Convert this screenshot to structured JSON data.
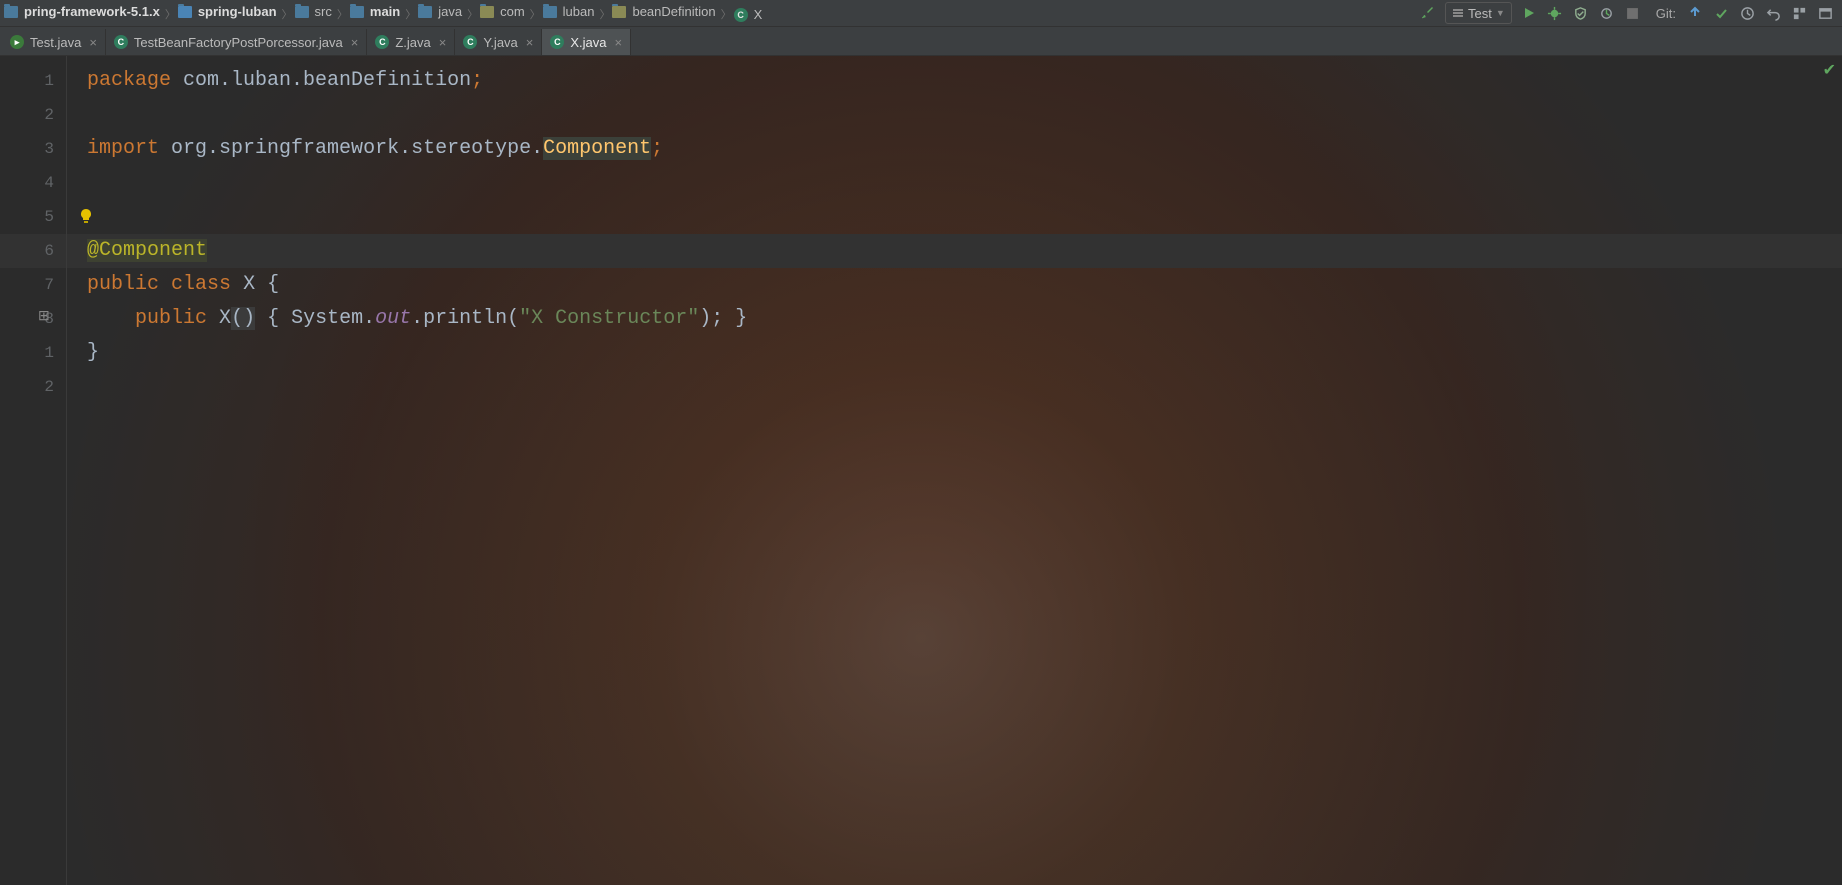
{
  "breadcrumbs": [
    {
      "label": "pring-framework-5.1.x",
      "icon": "folder",
      "bold": true
    },
    {
      "label": "spring-luban",
      "icon": "module",
      "bold": true
    },
    {
      "label": "src",
      "icon": "folder",
      "bold": false
    },
    {
      "label": "main",
      "icon": "folder",
      "bold": true
    },
    {
      "label": "java",
      "icon": "folder",
      "bold": false
    },
    {
      "label": "com",
      "icon": "pkg",
      "bold": false
    },
    {
      "label": "luban",
      "icon": "folder",
      "bold": false
    },
    {
      "label": "beanDefinition",
      "icon": "pkg",
      "bold": false
    },
    {
      "label": "X",
      "icon": "class",
      "bold": false
    }
  ],
  "run_config": "Test",
  "git_label": "Git:",
  "tabs": [
    {
      "label": "Test.java",
      "icon": "run",
      "active": false
    },
    {
      "label": "TestBeanFactoryPostPorcessor.java",
      "icon": "jclass",
      "active": false
    },
    {
      "label": "Z.java",
      "icon": "jclass",
      "active": false
    },
    {
      "label": "Y.java",
      "icon": "jclass",
      "active": false
    },
    {
      "label": "X.java",
      "icon": "jclass",
      "active": true
    }
  ],
  "gutter": [
    "1",
    "2",
    "3",
    "4",
    "5",
    "6",
    "7",
    "8",
    "1",
    "2"
  ],
  "code": {
    "l1": {
      "kw": "package",
      "sp": " ",
      "rest": "com.luban.beanDefinition",
      "semi": ";"
    },
    "l3": {
      "kw": "import",
      "sp": " ",
      "pkg": "org.springframework.stereotype.",
      "cls": "Component",
      "semi": ";"
    },
    "l6": {
      "ann": "@Component"
    },
    "l7": {
      "kw1": "public",
      "sp1": " ",
      "kw2": "class",
      "sp2": " ",
      "name": "X ",
      "brace": "{"
    },
    "l8": {
      "indent": "    ",
      "kw": "public",
      "sp": " ",
      "ctor": "X",
      "paren": "()",
      "sp2": " ",
      "ob": "{ ",
      "sys": "System.",
      "out": "out",
      "dot": ".",
      "prn": "println(",
      "str": "\"X Constructor\"",
      "close": "); ",
      "cb": "}"
    },
    "l9": {
      "brace": "}"
    }
  }
}
